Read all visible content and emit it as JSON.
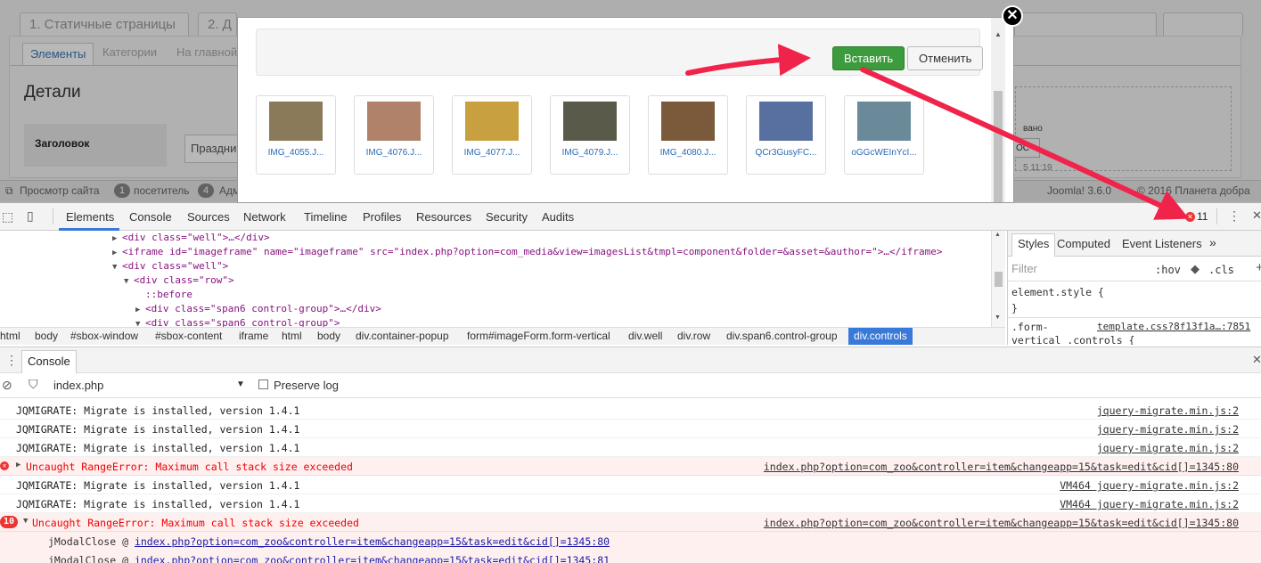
{
  "background_page": {
    "tabs": [
      "1. Статичные страницы",
      "2. Д"
    ],
    "subtabs": [
      "Элементы",
      "Категории",
      "На главной"
    ],
    "section_title": "Детали",
    "field_label": "Заголовок",
    "field_value": "Праздни",
    "right_text1": "вано",
    "right_text2": "ОС",
    "right_text3": "5 11:19",
    "status": {
      "view_site": "Просмотр сайта",
      "visitors_count": "1",
      "visitors_label": "посетитель",
      "admins_count": "4",
      "admins_label": "Адм",
      "joomla": "Joomla! 3.6.0",
      "copyright": "© 2016 Планета добра"
    }
  },
  "modal": {
    "insert_label": "Вставить",
    "cancel_label": "Отменить",
    "close_glyph": "✕",
    "images": [
      {
        "name": "IMG_4055.J...",
        "color": "#8a7a5a"
      },
      {
        "name": "IMG_4076.J...",
        "color": "#b0826a"
      },
      {
        "name": "IMG_4077.J...",
        "color": "#c9a040"
      },
      {
        "name": "IMG_4079.J...",
        "color": "#5a5a4a"
      },
      {
        "name": "IMG_4080.J...",
        "color": "#7a5a3a"
      },
      {
        "name": "QCr3GusyFC...",
        "color": "#5870a0"
      },
      {
        "name": "oGGcWEInYcI...",
        "color": "#6a8a9a"
      }
    ]
  },
  "devtools": {
    "tabs": [
      "Elements",
      "Console",
      "Sources",
      "Network",
      "Timeline",
      "Profiles",
      "Resources",
      "Security",
      "Audits"
    ],
    "error_count": "11",
    "elements": [
      {
        "indent": 0,
        "arrow": "▶",
        "html": "<div class=\"well\">…</div>"
      },
      {
        "indent": 0,
        "arrow": "▶",
        "html": "<iframe id=\"imageframe\" name=\"imageframe\" src=\"index.php?option=com_media&view=imagesList&tmpl=component&folder=&asset=&author=\">…</iframe>"
      },
      {
        "indent": 0,
        "arrow": "▼",
        "html": "<div class=\"well\">"
      },
      {
        "indent": 1,
        "arrow": "▼",
        "html": "<div class=\"row\">"
      },
      {
        "indent": 2,
        "arrow": "",
        "html": "::before"
      },
      {
        "indent": 2,
        "arrow": "▶",
        "html": "<div class=\"span6 control-group\">…</div>"
      },
      {
        "indent": 2,
        "arrow": "▼",
        "html": "<div class=\"span6 control-group\">"
      }
    ],
    "breadcrumb": [
      "html",
      "body",
      "#sbox-window",
      "#sbox-content",
      "iframe",
      "html",
      "body",
      "div.container-popup",
      "form#imageForm.form-vertical",
      "div.well",
      "div.row",
      "div.span6.control-group"
    ],
    "breadcrumb_active": "div.controls",
    "styles": {
      "tabs": [
        "Styles",
        "Computed",
        "Event Listeners",
        "»"
      ],
      "filter_placeholder": "Filter",
      "hov": ":hov",
      "cls": ".cls",
      "element_style": "element.style {",
      "close_brace": "}",
      "rule_selector_1": ".form-",
      "rule_selector_2": "vertical .controls {",
      "rule_source": "template.css?8f13f1a…:7851"
    },
    "console": {
      "drawer_tab": "Console",
      "context": "index.php",
      "preserve_log": "Preserve log",
      "messages": [
        {
          "type": "log",
          "text": "JQMIGRATE: Migrate is installed, version 1.4.1",
          "source": "jquery-migrate.min.js:2"
        },
        {
          "type": "log",
          "text": "JQMIGRATE: Migrate is installed, version 1.4.1",
          "source": "jquery-migrate.min.js:2"
        },
        {
          "type": "log",
          "text": "JQMIGRATE: Migrate is installed, version 1.4.1",
          "source": "jquery-migrate.min.js:2"
        },
        {
          "type": "error",
          "arrow": "▶",
          "text": "Uncaught RangeError: Maximum call stack size exceeded",
          "source": "index.php?option=com_zoo&controller=item&changeapp=15&task=edit&cid[]=1345:80"
        },
        {
          "type": "log",
          "text": "JQMIGRATE: Migrate is installed, version 1.4.1",
          "source": "VM464 jquery-migrate.min.js:2"
        },
        {
          "type": "log",
          "text": "JQMIGRATE: Migrate is installed, version 1.4.1",
          "source": "VM464 jquery-migrate.min.js:2"
        },
        {
          "type": "error",
          "count": "10",
          "arrow": "▼",
          "text": "Uncaught RangeError: Maximum call stack size exceeded",
          "source": "index.php?option=com_zoo&controller=item&changeapp=15&task=edit&cid[]=1345:80"
        }
      ],
      "stack": [
        {
          "fn": "jModalClose @ ",
          "link": "index.php?option=com_zoo&controller=item&changeapp=15&task=edit&cid[]=1345:80"
        },
        {
          "fn": "jModalClose @ ",
          "link": "index.php?option=com_zoo&controller=item&changeapp=15&task=edit&cid[]=1345:81"
        }
      ]
    }
  },
  "colors": {
    "arrow": "#f0244a",
    "accent": "#3879d9",
    "error": "#e33333",
    "insert_btn": "#3c9b3c"
  }
}
